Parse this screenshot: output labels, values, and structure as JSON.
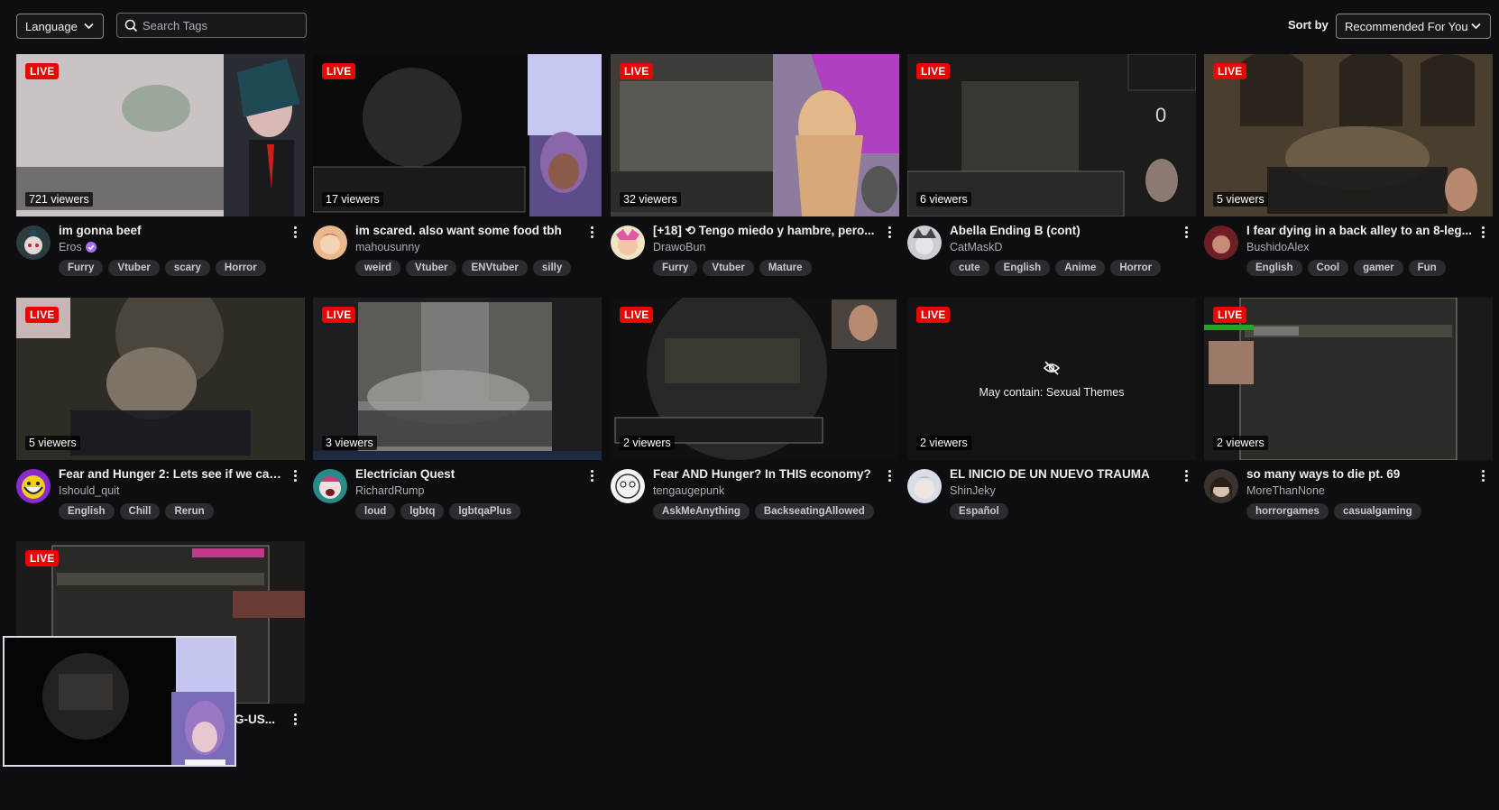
{
  "toolbar": {
    "language_label": "Language",
    "search_placeholder": "Search Tags",
    "sort_by_label": "Sort by",
    "sort_value": "Recommended For You"
  },
  "live_badge": "LIVE",
  "cards": [
    {
      "title": "im gonna beef",
      "channel": "Eros",
      "viewers": "721 viewers",
      "tags": [
        "Furry",
        "Vtuber",
        "scary",
        "Horror"
      ],
      "verified": true
    },
    {
      "title": "im scared. also want some food tbh",
      "channel": "mahousunny",
      "viewers": "17 viewers",
      "tags": [
        "weird",
        "Vtuber",
        "ENVtuber",
        "silly"
      ]
    },
    {
      "title": "[+18] ⟲ Tengo miedo y hambre, pero...",
      "channel": "DrawoBun",
      "viewers": "32 viewers",
      "tags": [
        "Furry",
        "Vtuber",
        "Mature"
      ]
    },
    {
      "title": "Abella Ending B (cont)",
      "channel": "CatMaskD",
      "viewers": "6 viewers",
      "tags": [
        "cute",
        "English",
        "Anime",
        "Horror"
      ]
    },
    {
      "title": "I fear dying in a back alley to an 8-leg...",
      "channel": "BushidoAlex",
      "viewers": "5 viewers",
      "tags": [
        "English",
        "Cool",
        "gamer",
        "Fun"
      ]
    },
    {
      "title": "Fear and Hunger 2: Lets see if we can ...",
      "channel": "Ishould_quit",
      "viewers": "5 viewers",
      "tags": [
        "English",
        "Chill",
        "Rerun"
      ]
    },
    {
      "title": "Electrician Quest",
      "channel": "RichardRump",
      "viewers": "3 viewers",
      "tags": [
        "loud",
        "lgbtq",
        "lgbtqaPlus"
      ]
    },
    {
      "title": "Fear AND Hunger? In THIS economy?",
      "channel": "tengaugepunk",
      "viewers": "2 viewers",
      "tags": [
        "AskMeAnything",
        "BackseatingAllowed"
      ]
    },
    {
      "title": "EL INICIO DE UN NUEVO TRAUMA",
      "channel": "ShinJeky",
      "viewers": "2 viewers",
      "tags": [
        "Español"
      ],
      "mature_notice": "May contain: Sexual Themes"
    },
    {
      "title": "so many ways to die pt. 69",
      "channel": "MoreThanNone",
      "viewers": "2 viewers",
      "tags": [
        "horrorgames",
        "casualgaming"
      ]
    },
    {
      "title": "G-US...",
      "channel": "",
      "viewers": "",
      "tags": []
    }
  ],
  "colors": {
    "background": "#0e0e10",
    "live_red": "#eb0400",
    "tag_bg": "#2c2c30",
    "accent_purple": "#a970ff"
  }
}
